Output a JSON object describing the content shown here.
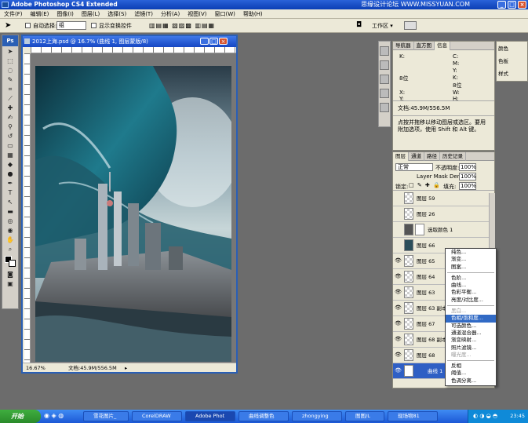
{
  "app": {
    "title": "Adobe Photoshop CS4 Extended",
    "watermark": "思缘设计论坛 WWW.MISSYUAN.COM"
  },
  "menu": [
    "文件(F)",
    "编辑(E)",
    "图像(I)",
    "图层(L)",
    "选择(S)",
    "滤镜(T)",
    "分析(A)",
    "视图(V)",
    "窗口(W)",
    "帮助(H)"
  ],
  "options": {
    "auto_select_label": "自动选择:",
    "auto_select_value": "组",
    "show_transform_label": "显示变换控件",
    "workspace_label": "工作区 ▾"
  },
  "document": {
    "title": "2012上海.psd @ 16.7% (曲线 1, 图层蒙版/8)",
    "zoom": "16.67%",
    "doc_size": "文档:45.9M/556.5M"
  },
  "info_panel": {
    "tabs": [
      "导航器",
      "直方图",
      "信息"
    ],
    "active_tab": "信息",
    "rows": [
      {
        "left": "K:",
        "right": "C:"
      },
      {
        "left": "",
        "right": "M:"
      },
      {
        "left": "",
        "right": "Y:"
      },
      {
        "left": "8位",
        "right": "K:"
      },
      {
        "left": "",
        "right": "8位"
      },
      {
        "left": "X:",
        "right": "W:"
      },
      {
        "left": "Y:",
        "right": "H:"
      }
    ],
    "doc_size": "文档:45.9M/556.5M",
    "hint": "点按并拖移以移动图层或选区。要用附加选项，使用 Shift 和 Alt 键。"
  },
  "color_panel": {
    "items": [
      "颜色",
      "色板",
      "样式"
    ]
  },
  "layers_panel": {
    "tabs": [
      "图层",
      "通道",
      "路径",
      "历史记录"
    ],
    "blend_mode": "正常",
    "opacity_label": "不透明度:",
    "opacity": "100%",
    "density_label": "Layer Mask Density",
    "density": "100%",
    "lock_label": "锁定:",
    "fill_label": "填充:",
    "fill": "100%",
    "layers": [
      "图层 59",
      "图层 26",
      "选取颜色 1",
      "图层 66",
      "图层 65",
      "图层 64",
      "图层 63",
      "图层 63 副本",
      "图层 67",
      "图层 68 副本",
      "图层 68",
      "曲线 1"
    ]
  },
  "context_menu": {
    "items": [
      "纯色...",
      "渐变...",
      "图案...",
      "-",
      "色阶...",
      "曲线...",
      "色彩平衡...",
      "亮度/对比度...",
      "-",
      "黑白...",
      "色相/饱和度...",
      "可选颜色...",
      "通道混合器...",
      "渐变映射...",
      "照片滤镜...",
      "曝光度...",
      "-",
      "反相",
      "阈值...",
      "色调分离..."
    ],
    "highlighted": "色相/饱和度...",
    "disabled": [
      "黑白...",
      "曝光度..."
    ]
  },
  "taskbar": {
    "start": "开始",
    "tasks": [
      "雪花图片_",
      "CorelDRAW",
      "Adobe Phot",
      "曲线调整色",
      "zhongying",
      "图图/L",
      "现场物81"
    ],
    "active": "Adobe Phot",
    "time": "23:45"
  }
}
